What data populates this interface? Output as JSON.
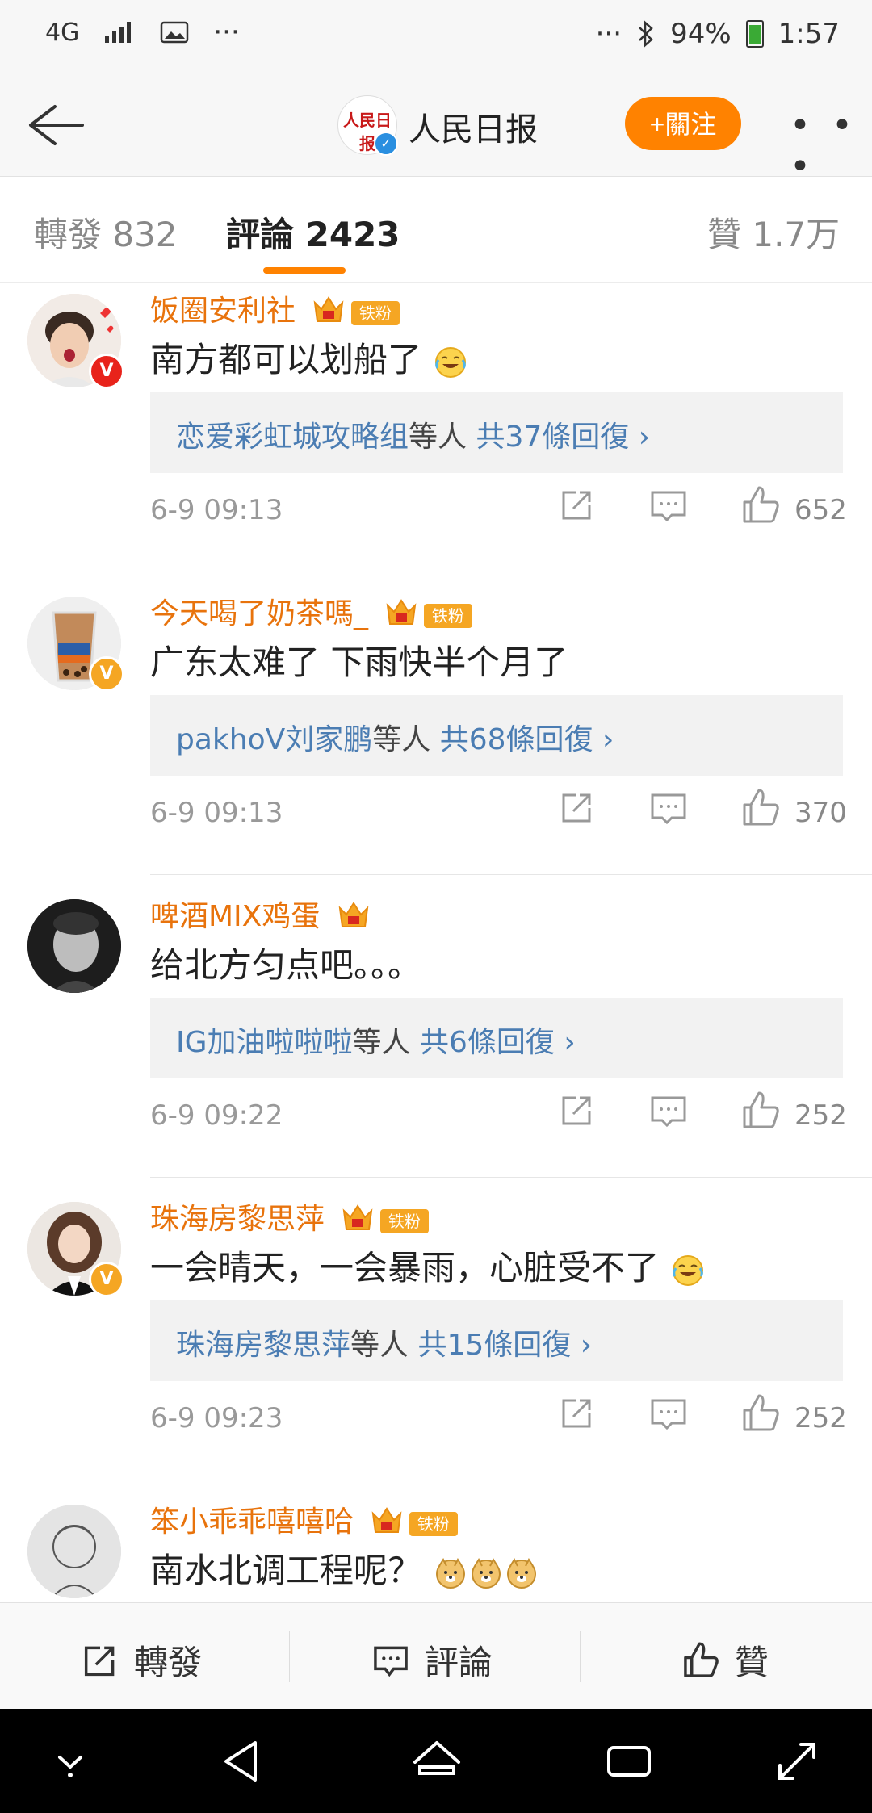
{
  "status_bar": {
    "network": "4G",
    "signal": "signal-icon",
    "gallery": "image-icon",
    "dots_left": "···",
    "dots_right": "···",
    "battery": "94%",
    "time": "1:57"
  },
  "header": {
    "title": "人民日报",
    "logo_text": "人民日报",
    "follow_label": "+關注",
    "more": "• • •"
  },
  "tabs": {
    "repost": "轉發 832",
    "comments": "評論 2423",
    "likes": "贊 1.7万"
  },
  "comments": [
    {
      "user": "饭圈安利社",
      "fan_badge": "铁粉",
      "text": "南方都可以划船了",
      "emoji_count": 1,
      "reply_names": "恋爱彩虹城攻略组",
      "reply_etc": "等人",
      "reply_count": "共37條回復 ›",
      "time": "6-9 09:13",
      "likes": "652",
      "badge_color": "#e8231b"
    },
    {
      "user": "今天喝了奶茶嗎_",
      "fan_badge": "铁粉",
      "text": "广东太难了 下雨快半个月了",
      "emoji_count": 0,
      "reply_names": "pakhoV刘家鹏",
      "reply_etc": "等人",
      "reply_count": "共68條回復 ›",
      "time": "6-9 09:13",
      "likes": "370",
      "badge_color": "#f5a623"
    },
    {
      "user": "啤酒MIX鸡蛋",
      "fan_badge": "",
      "text": "给北方匀点吧。。。",
      "emoji_count": 0,
      "reply_names": "IG加油啦啦啦",
      "reply_etc": "等人",
      "reply_count": "共6條回復 ›",
      "time": "6-9 09:22",
      "likes": "252",
      "badge_color": ""
    },
    {
      "user": "珠海房黎思萍",
      "fan_badge": "铁粉",
      "text": "一会晴天，一会暴雨，心脏受不了",
      "emoji_count": 1,
      "reply_names": "珠海房黎思萍",
      "reply_etc": "等人",
      "reply_count": "共15條回復 ›",
      "time": "6-9 09:23",
      "likes": "252",
      "badge_color": "#f5a623"
    },
    {
      "user": "笨小乖乖嘻嘻哈",
      "fan_badge": "铁粉",
      "text": "南水北调工程呢？",
      "emoji_count": 3
    }
  ],
  "bottom_bar": {
    "repost": "轉發",
    "comment": "評論",
    "like": "贊"
  },
  "colors": {
    "accent": "#ff8200",
    "username": "#e8730c",
    "link": "#4b7db3"
  }
}
